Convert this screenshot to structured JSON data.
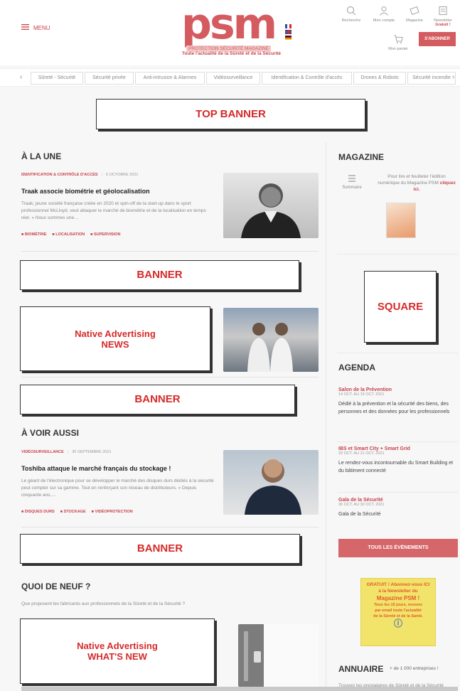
{
  "header": {
    "menu_label": "MENU",
    "logo_text": "psm",
    "logo_subtitle": "PROTECTION SÉCURITÉ MAGAZINE",
    "tagline": "Toute l'actualité de la Sûreté et de la Sécurité",
    "icons": [
      {
        "icon": "search-icon",
        "label": "Recherche"
      },
      {
        "icon": "user-icon",
        "label": "Mon compte"
      },
      {
        "icon": "magazine-icon",
        "label": "Magazine"
      },
      {
        "icon": "newsletter-icon",
        "label": "Newsletter",
        "badge": "Gratuit !"
      }
    ],
    "cart_label": "Mon panier",
    "subscribe_label": "S'ABONNER"
  },
  "nav": {
    "items": [
      "Sûreté - Sécurité",
      "Sécurité privée",
      "Anti-intrusion & Alarmes",
      "Vidéosurveillance",
      "Identification & Contrôle d'accès",
      "Drones & Robots",
      "Sécurité incendie"
    ]
  },
  "top_banner": "TOP BANNER",
  "a_la_une": {
    "title": "À LA UNE",
    "category": "IDENTIFICATION & CONTRÔLE D'ACCÈS",
    "date": "6 OCTOBRE 2021",
    "headline": "Traak associe biométrie et géolocalisation",
    "excerpt": "Traak, jeune société française créée en 2020 et spin-off de la start-up dans le sport professionnel McLloyd, veut attaquer le marché de biométrie et de la localisation en temps réel. « Nous sommes une…",
    "tags": [
      "BIOMÉTRIE",
      "LOCALISATION",
      "SUPERVISION"
    ]
  },
  "banner_label": "BANNER",
  "native_news": {
    "line1": "Native Advertising",
    "line2": "NEWS"
  },
  "a_voir_aussi": {
    "title": "À VOIR AUSSI",
    "category": "VIDÉOSURVEILLANCE",
    "date": "30 SEPTEMBRE 2021",
    "headline": "Toshiba attaque le marché français du stockage !",
    "excerpt": "Le géant de l'électronique pour se développer le marché des disques durs dédiés à la sécurité peut compter sur sa gamme. Tout en renforçant son réseau de distributeurs. « Depuis cinquante ans,…",
    "tags": [
      "DISQUES DURS",
      "STOCKAGE",
      "VIDÉOPROTECTION"
    ]
  },
  "quoi_de_neuf": {
    "title": "QUOI DE NEUF ?",
    "subtitle": "Que proposent les fabricants aux professionnels de la Sûreté et de la Sécurité ?"
  },
  "native_whatsnew": {
    "line1": "Native Advertising",
    "line2": "WHAT'S NEW"
  },
  "sidebar": {
    "magazine": {
      "title": "MAGAZINE",
      "summary_label": "Sommaire",
      "text": "Pour lire et feuilleter l'édition numérique du Magazine PSM",
      "link": "cliquez ici."
    },
    "square_label": "SQUARE",
    "agenda": {
      "title": "AGENDA",
      "events": [
        {
          "title": "Salon de la Prévention",
          "date": "14 OCT. AU 15 OCT. 2021",
          "desc": "Dédié à la prévention et la sécurité des biens, des personnes et des données pour les professionnels"
        },
        {
          "title": "IBS et Smart City + Smart Grid",
          "date": "20 OCT. AU 21 OCT. 2021",
          "desc": "Le rendez-vous incontournable du Smart Building et du bâtiment connecté"
        },
        {
          "title": "Gala de la Sécurité",
          "date": "30 OCT. AU 30 OCT. 2021",
          "desc": "Gala de la Sécurité"
        }
      ],
      "all_events_label": "TOUS LES ÉVÈNEMENTS"
    },
    "newsletter_ad": {
      "line1": "GRATUIT ! Abonnez-vous ICI",
      "line2": "à la Newsletter du",
      "line3": "Magazine PSM !",
      "line4": "Tous les 15 jours, recevez",
      "line5": "par email toute l'actualité",
      "line6": "de la Sûreté et de la Santé."
    },
    "annuaire": {
      "title": "ANNUAIRE",
      "count": "+ de 1 000 entreprises !",
      "text": "Trouvez les prestataires de Sûreté et de la Sécurité"
    }
  },
  "colors": {
    "brand": "#c8424a",
    "ad_red": "#d62a2a",
    "ad_border": "#333333"
  }
}
